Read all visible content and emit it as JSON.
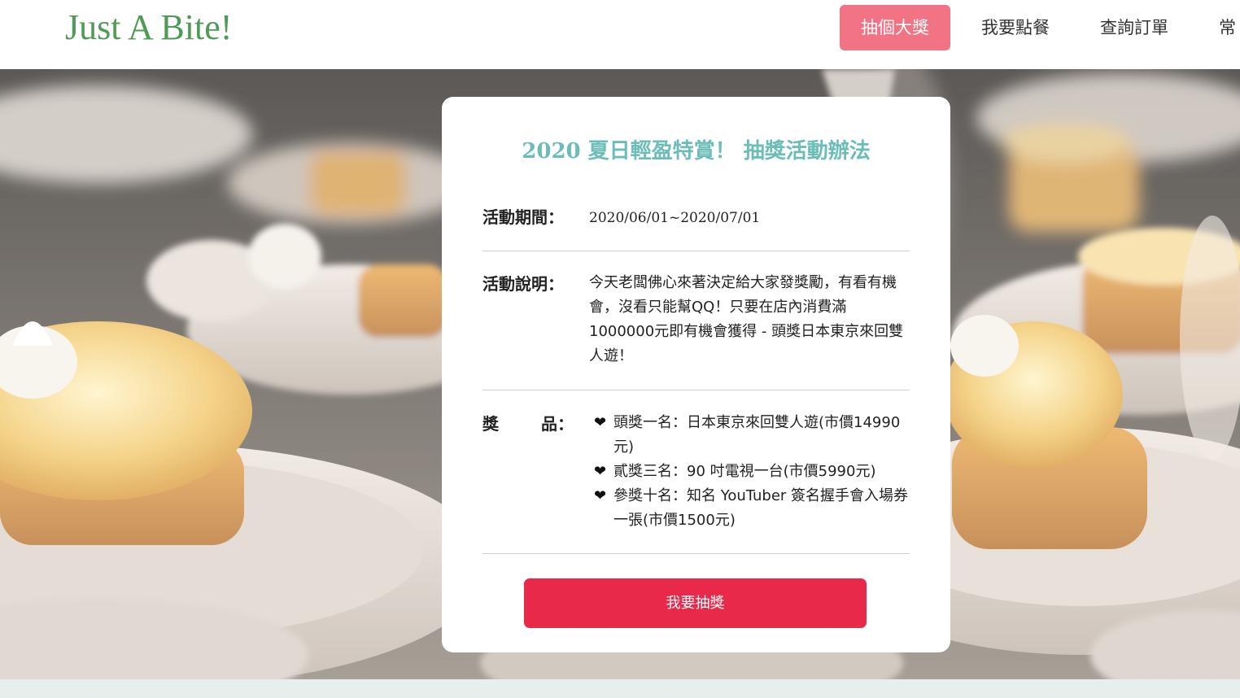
{
  "header": {
    "logo": "Just A Bite!",
    "nav": [
      {
        "label": "抽個大獎",
        "active": true
      },
      {
        "label": "我要點餐",
        "active": false
      },
      {
        "label": "查詢訂單",
        "active": false
      },
      {
        "label": "常",
        "active": false
      }
    ]
  },
  "card": {
    "title": "2020 夏日輕盈特賞！ 抽獎活動辦法",
    "period": {
      "label": "活動期間：",
      "value": "2020/06/01~2020/07/01"
    },
    "description": {
      "label": "活動說明：",
      "value": "今天老闆佛心來著決定給大家發獎勵，有看有機會，沒看只能幫QQ！只要在店內消費滿1000000元即有機會獲得 - 頭獎日本東京來回雙人遊！"
    },
    "prizes": {
      "label_left": "獎",
      "label_right": "品：",
      "items": [
        "頭獎一名：日本東京來回雙人遊(市價14990元)",
        "貳獎三名：90 吋電視一台(市價5990元)",
        "參獎十名：知名 YouTuber 簽名握手會入場券一張(市價1500元)"
      ],
      "bullet_icon": "heart-icon"
    },
    "button_label": "我要抽獎"
  },
  "colors": {
    "brand_green": "#4f9a55",
    "nav_active": "#f27383",
    "title_teal": "#6cbcb8",
    "button_red": "#e8294a"
  }
}
